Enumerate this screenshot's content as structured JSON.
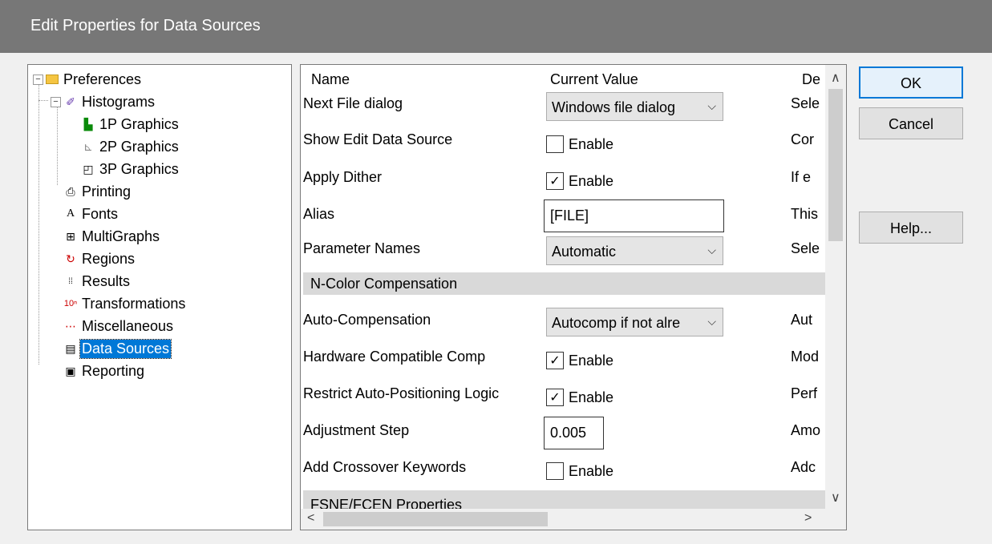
{
  "window": {
    "title": "Edit Properties for Data Sources"
  },
  "tree": {
    "root": "Preferences",
    "histograms": "Histograms",
    "items": [
      {
        "label": "1P Graphics",
        "icon": "histogram-1p-icon"
      },
      {
        "label": "2P Graphics",
        "icon": "histogram-2p-icon"
      },
      {
        "label": "3P Graphics",
        "icon": "histogram-3p-icon"
      },
      {
        "label": "Printing",
        "icon": "printer-icon"
      },
      {
        "label": "Fonts",
        "icon": "font-icon"
      },
      {
        "label": "MultiGraphs",
        "icon": "multigraph-icon"
      },
      {
        "label": "Regions",
        "icon": "regions-icon"
      },
      {
        "label": "Results",
        "icon": "results-icon"
      },
      {
        "label": "Transformations",
        "icon": "transformations-icon"
      },
      {
        "label": "Miscellaneous",
        "icon": "miscellaneous-icon"
      },
      {
        "label": "Data Sources",
        "icon": "data-sources-icon",
        "selected": true
      },
      {
        "label": "Reporting",
        "icon": "reporting-icon"
      }
    ]
  },
  "grid": {
    "headers": {
      "name": "Name",
      "value": "Current Value",
      "desc": "De"
    },
    "rows": {
      "next_file": {
        "name": "Next File dialog",
        "value": "Windows file dialog",
        "desc": "Sele"
      },
      "show_edit": {
        "name": "Show Edit Data Source",
        "value": "Enable",
        "checked": false,
        "desc": "Cor"
      },
      "apply_dither": {
        "name": "Apply Dither",
        "value": "Enable",
        "checked": true,
        "desc": "If e"
      },
      "alias": {
        "name": "Alias",
        "value": "[FILE]",
        "desc": "This"
      },
      "param_names": {
        "name": "Parameter Names",
        "value": "Automatic",
        "desc": "Sele"
      },
      "section_ncolor": {
        "name": "N-Color Compensation"
      },
      "auto_comp": {
        "name": "Auto-Compensation",
        "value": "Autocomp if not alre",
        "desc": "Aut"
      },
      "hw_comp": {
        "name": "Hardware Compatible Comp",
        "value": "Enable",
        "checked": true,
        "desc": "Mod"
      },
      "restrict": {
        "name": "Restrict Auto-Positioning Logic",
        "value": "Enable",
        "checked": true,
        "desc": "Perf"
      },
      "adj_step": {
        "name": "Adjustment Step",
        "value": "0.005",
        "desc": "Amo"
      },
      "crossover": {
        "name": "Add Crossover Keywords",
        "value": "Enable",
        "checked": false,
        "desc": "Adc"
      },
      "section_fsne": {
        "name": "FSNE/FCEN Properties"
      }
    }
  },
  "buttons": {
    "ok": "OK",
    "cancel": "Cancel",
    "help": "Help..."
  },
  "glyphs": {
    "check": "✓",
    "chev": "⌵",
    "up": "∧",
    "down": "∨",
    "left": "<",
    "right": ">",
    "minus": "−"
  }
}
